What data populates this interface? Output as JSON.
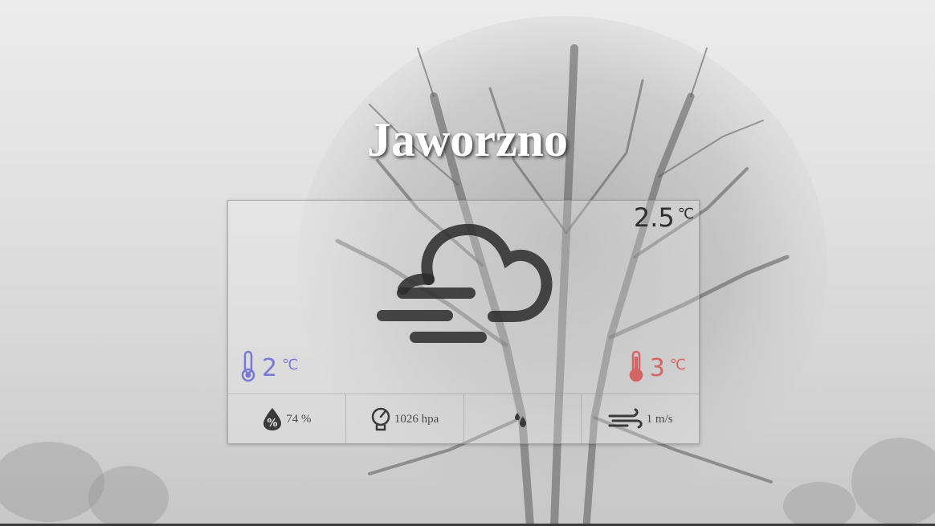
{
  "city": "Jaworzno",
  "current": {
    "temp": "2.5",
    "unit": "℃",
    "condition_icon": "fog-cloud-icon"
  },
  "temp_min": {
    "value": "2",
    "unit": "℃",
    "icon": "thermometer-cold-icon",
    "color": "#7a78d6"
  },
  "temp_max": {
    "value": "3",
    "unit": "℃",
    "icon": "thermometer-hot-icon",
    "color": "#d84a4a"
  },
  "stats": {
    "humidity": {
      "value": "74 %",
      "icon": "humidity-percent-icon"
    },
    "pressure": {
      "value": "1026 hpa",
      "icon": "barometer-icon"
    },
    "precipitation": {
      "value": "",
      "icon": "raindrops-icon"
    },
    "wind": {
      "value": "1 m/s",
      "icon": "wind-icon"
    }
  }
}
